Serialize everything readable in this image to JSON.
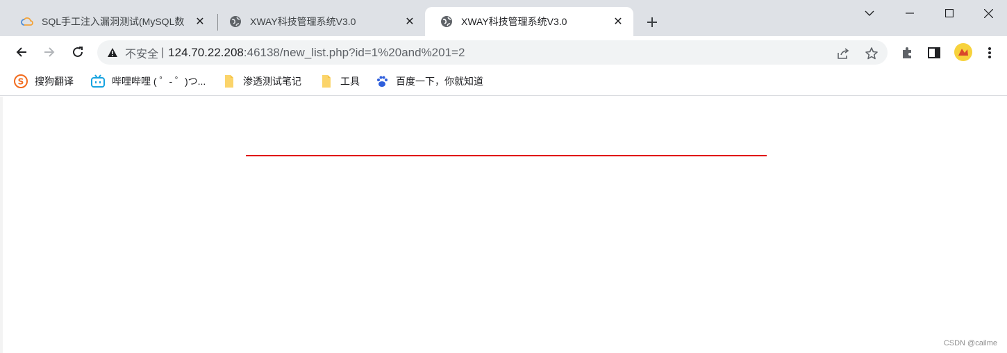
{
  "tabs": [
    {
      "title": "SQL手工注入漏洞测试(MySQL数",
      "favicon": "cloud-icon",
      "active": false
    },
    {
      "title": "XWAY科技管理系统V3.0",
      "favicon": "globe-icon",
      "active": false
    },
    {
      "title": "XWAY科技管理系统V3.0",
      "favicon": "globe-icon",
      "active": true
    }
  ],
  "omnibox": {
    "security_label": "不安全",
    "separator": "|",
    "host": "124.70.22.208",
    "path": ":46138/new_list.php?id=1%20and%201=2"
  },
  "bookmarks": [
    {
      "label": "搜狗翻译",
      "icon": "sogou-icon"
    },
    {
      "label": "哔哩哔哩 ( ゜- ゜)つ...",
      "icon": "bilibili-icon"
    },
    {
      "label": "渗透测试笔记",
      "icon": "folder-icon"
    },
    {
      "label": "工具",
      "icon": "folder-icon"
    },
    {
      "label": "百度一下，你就知道",
      "icon": "baidu-paw-icon"
    }
  ],
  "content": {
    "watermark": "CSDN @cailme",
    "line_color": "#e01010"
  },
  "colors": {
    "tabstrip": "#dee1e6",
    "omnibox": "#f1f3f4"
  }
}
